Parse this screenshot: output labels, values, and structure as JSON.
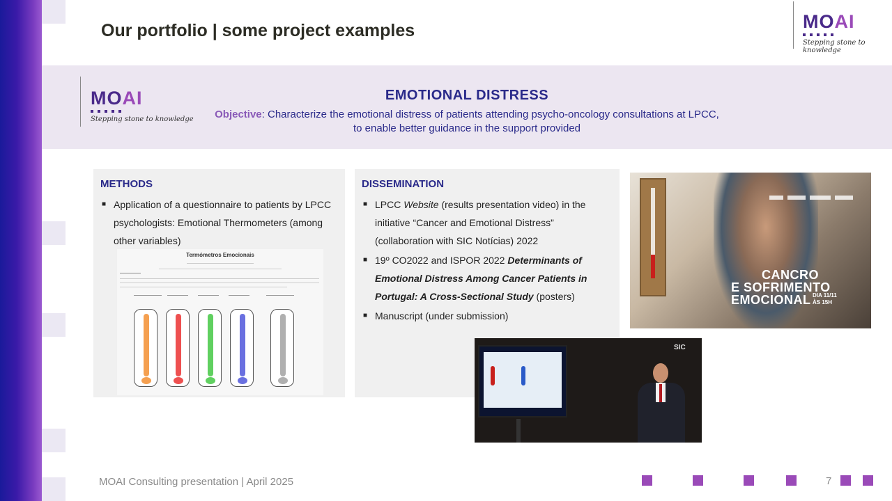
{
  "slide_title": "Our portfolio | some project examples",
  "logo": {
    "word_main": "MO",
    "word_accent": "AI",
    "tagline": "Stepping stone to knowledge"
  },
  "band": {
    "title": "EMOTIONAL  DISTRESS",
    "objective_label": "Objective",
    "objective_text": ": Characterize the emotional distress of patients attending psycho-oncology consultations at LPCC,",
    "objective_text_2": "to enable better guidance in the support provided"
  },
  "methods": {
    "heading": "METHODS",
    "items": [
      "Application of a questionnaire to patients by LPCC psychologists: Emotional Thermometers (among other variables)"
    ],
    "image_title": "Termómetros Emocionais"
  },
  "dissemination": {
    "heading": "DISSEMINATION",
    "item1": {
      "a": "LPCC ",
      "b": "Website",
      "c": " (results presentation video) in the initiative “Cancer and Emotional Distress” (collaboration with SIC Notícias) 2022"
    },
    "item2": {
      "a": "19º CO2022 and ISPOR 2022 ",
      "b": "Determinants of Emotional Distress Among Cancer Patients in Portugal: A Cross-Sectional Study",
      "c": " (posters)"
    },
    "item3": "Manuscript (under submission)"
  },
  "poster": {
    "line1": "CANCRO",
    "line2": "E SOFRIMENTO",
    "line3": "EMOCIONAL",
    "date1": "DIA 11/11",
    "date2": "ÀS 15H"
  },
  "video": {
    "channel": "SIC"
  },
  "footer": {
    "text": "MOAI Consulting  presentation | April 2025",
    "page": "7"
  },
  "colors": {
    "brand_purple": "#4a2a8a",
    "accent_purple": "#9a4ab8",
    "navy_text": "#2a2a8a",
    "band_bg": "#ece6f1"
  }
}
